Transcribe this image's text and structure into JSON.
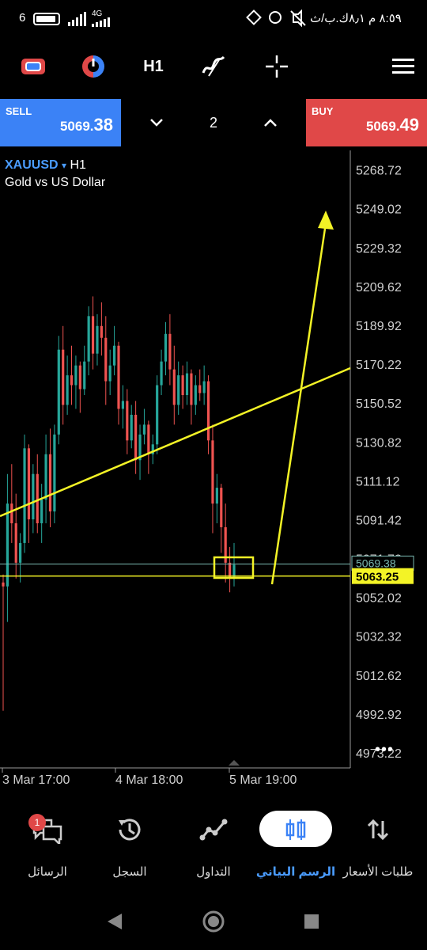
{
  "status_bar": {
    "time": "٨:٥٩ م",
    "left_signal": "6",
    "network": "4G",
    "right_info": "٨٫١ك.ب/ث"
  },
  "toolbar": {
    "timeframe": "H1"
  },
  "trade": {
    "sell_label": "SELL",
    "sell_price_main": "5069.",
    "sell_price_big": "38",
    "lot_value": "2",
    "buy_label": "BUY",
    "buy_price_main": "5069.",
    "buy_price_big": "49"
  },
  "chart_info": {
    "symbol": "XAUUSD",
    "symbol_arrow": "▾",
    "timeframe": "H1",
    "description": "Gold vs US Dollar",
    "current_price_label": "5069.38",
    "horizontal_line_label": "5063.25",
    "more": "•••"
  },
  "chart_data": {
    "type": "candlestick",
    "ylim": [
      4966.0,
      5279.0
    ],
    "y_ticks": [
      "5268.72",
      "5249.02",
      "5229.32",
      "5209.62",
      "5189.92",
      "5170.22",
      "5150.52",
      "5130.82",
      "5111.12",
      "5091.42",
      "5071.72",
      "5052.02",
      "5032.32",
      "5012.62",
      "4992.92",
      "4973.22"
    ],
    "x_tick_labels": [
      "3 Mar 17:00",
      "4 Mar 18:00",
      "5 Mar 19:00"
    ],
    "current_price": 5069.38,
    "horizontal_line": 5063.25,
    "colors": {
      "up": "#26a69a",
      "down": "#ef5350",
      "annotation": "#f3f326",
      "current_line": "#7ab8b0"
    },
    "candles": [
      [
        5060,
        5064,
        4995,
        5058
      ],
      [
        5058,
        5115,
        5040,
        5100
      ],
      [
        5100,
        5120,
        5080,
        5090
      ],
      [
        5090,
        5105,
        5062,
        5070
      ],
      [
        5070,
        5085,
        5060,
        5080
      ],
      [
        5080,
        5135,
        5075,
        5128
      ],
      [
        5128,
        5130,
        5080,
        5092
      ],
      [
        5092,
        5120,
        5085,
        5115
      ],
      [
        5115,
        5125,
        5085,
        5090
      ],
      [
        5090,
        5110,
        5080,
        5102
      ],
      [
        5102,
        5135,
        5090,
        5125
      ],
      [
        5125,
        5138,
        5088,
        5096
      ],
      [
        5096,
        5140,
        5090,
        5135
      ],
      [
        5135,
        5185,
        5130,
        5178
      ],
      [
        5178,
        5190,
        5140,
        5150
      ],
      [
        5150,
        5175,
        5145,
        5165
      ],
      [
        5165,
        5180,
        5150,
        5160
      ],
      [
        5160,
        5175,
        5148,
        5170
      ],
      [
        5170,
        5172,
        5146,
        5158
      ],
      [
        5158,
        5180,
        5155,
        5172
      ],
      [
        5172,
        5200,
        5165,
        5195
      ],
      [
        5195,
        5205,
        5168,
        5176
      ],
      [
        5176,
        5196,
        5170,
        5190
      ],
      [
        5190,
        5202,
        5175,
        5184
      ],
      [
        5184,
        5195,
        5150,
        5162
      ],
      [
        5162,
        5178,
        5155,
        5170
      ],
      [
        5170,
        5190,
        5165,
        5180
      ],
      [
        5180,
        5182,
        5140,
        5148
      ],
      [
        5148,
        5160,
        5138,
        5152
      ],
      [
        5152,
        5158,
        5125,
        5132
      ],
      [
        5132,
        5150,
        5128,
        5145
      ],
      [
        5145,
        5152,
        5115,
        5122
      ],
      [
        5122,
        5140,
        5112,
        5135
      ],
      [
        5135,
        5148,
        5130,
        5140
      ],
      [
        5140,
        5142,
        5115,
        5125
      ],
      [
        5125,
        5135,
        5120,
        5130
      ],
      [
        5130,
        5165,
        5125,
        5160
      ],
      [
        5160,
        5178,
        5155,
        5172
      ],
      [
        5172,
        5192,
        5165,
        5186
      ],
      [
        5186,
        5196,
        5160,
        5168
      ],
      [
        5168,
        5180,
        5140,
        5150
      ],
      [
        5150,
        5172,
        5145,
        5165
      ],
      [
        5165,
        5170,
        5148,
        5155
      ],
      [
        5155,
        5172,
        5150,
        5166
      ],
      [
        5166,
        5168,
        5140,
        5150
      ],
      [
        5150,
        5165,
        5145,
        5160
      ],
      [
        5160,
        5168,
        5152,
        5156
      ],
      [
        5156,
        5170,
        5150,
        5162
      ],
      [
        5162,
        5165,
        5125,
        5132
      ],
      [
        5132,
        5140,
        5085,
        5100
      ],
      [
        5100,
        5115,
        5090,
        5108
      ],
      [
        5108,
        5110,
        5075,
        5088
      ],
      [
        5088,
        5100,
        5060,
        5070
      ],
      [
        5070,
        5078,
        5055,
        5062
      ],
      [
        5062,
        5080,
        5058,
        5069
      ]
    ]
  },
  "nav": {
    "badge": "1",
    "messages": "الرسائل",
    "history": "السجل",
    "trade": "التداول",
    "chart": "الرسم البياني",
    "quotes": "طلبات الأسعار"
  }
}
